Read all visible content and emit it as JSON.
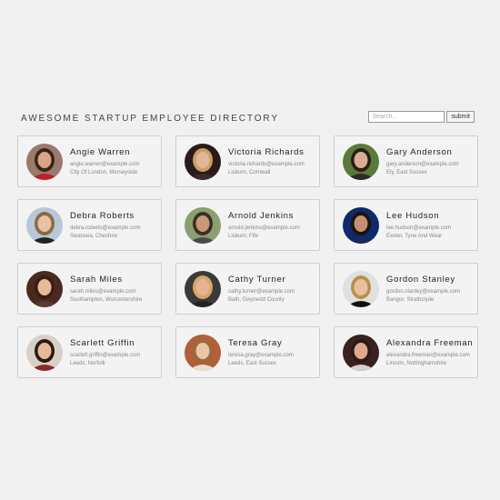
{
  "header": {
    "title": "AWESOME STARTUP EMPLOYEE DIRECTORY"
  },
  "search": {
    "placeholder": "Search...",
    "button_label": "submit"
  },
  "employees": [
    {
      "name": "Angie Warren",
      "email": "angie.warren@example.com",
      "location": "City Of London, Merseyside",
      "hair": "#3a2418",
      "skin": "#d9a58a",
      "bg": "#9a7a6a",
      "shirt": "#c0202a"
    },
    {
      "name": "Victoria Richards",
      "email": "victoria.richards@example.com",
      "location": "Lisburn, Cornwall",
      "hair": "#c8a060",
      "skin": "#e2b59a",
      "bg": "#2a1a1a",
      "shirt": "#3a2a30"
    },
    {
      "name": "Gary Anderson",
      "email": "gary.anderson@example.com",
      "location": "Ely, East Sussex",
      "hair": "#2a1e18",
      "skin": "#d8ae92",
      "bg": "#5a7a3a",
      "shirt": "#2a2a2a"
    },
    {
      "name": "Debra Roberts",
      "email": "debra.roberts@example.com",
      "location": "Swansea, Cheshire",
      "hair": "#8a6a40",
      "skin": "#e8c2a8",
      "bg": "#b8c8d8",
      "shirt": "#222"
    },
    {
      "name": "Arnold Jenkins",
      "email": "arnold.jenkins@example.com",
      "location": "Lisburn, Fife",
      "hair": "#3a2e22",
      "skin": "#c89878",
      "bg": "#8aa070",
      "shirt": "#4a4a48"
    },
    {
      "name": "Lee Hudson",
      "email": "lee.hudson@example.com",
      "location": "Exeter, Tyne And Wear",
      "hair": "#1a1410",
      "skin": "#c4906e",
      "bg": "#0e2a6a",
      "shirt": "#1a2a5a"
    },
    {
      "name": "Sarah Miles",
      "email": "sarah.miles@example.com",
      "location": "Southampton, Worcestershire",
      "hair": "#3a1e14",
      "skin": "#e8b89a",
      "bg": "#4a2a20",
      "shirt": "#5a3a30"
    },
    {
      "name": "Cathy Turner",
      "email": "cathy.turner@example.com",
      "location": "Bath, Gwynedd County",
      "hair": "#d4a860",
      "skin": "#e6b494",
      "bg": "#3a3a3a",
      "shirt": "#222"
    },
    {
      "name": "Gordon Stanley",
      "email": "gordon.stanley@example.com",
      "location": "Bangor, Strathclyde",
      "hair": "#b8904a",
      "skin": "#e8c0a0",
      "bg": "#e0e0e0",
      "shirt": "#111"
    },
    {
      "name": "Scarlett Griffin",
      "email": "scarlett.griffin@example.com",
      "location": "Leeds, Norfolk",
      "hair": "#2a1a14",
      "skin": "#e8b898",
      "bg": "#d8d0c8",
      "shirt": "#8a2a2a"
    },
    {
      "name": "Teresa Gray",
      "email": "teresa.gray@example.com",
      "location": "Leeds, East Sussex",
      "hair": "#9a6a3a",
      "skin": "#ecc4a6",
      "bg": "#b0603a",
      "shirt": "#e8e0d0"
    },
    {
      "name": "Alexandra Freeman",
      "email": "alexandra.freeman@example.com",
      "location": "Lincoln, Nottinghamshire",
      "hair": "#2a1a14",
      "skin": "#e0a88a",
      "bg": "#3a2020",
      "shirt": "#d8d0c8"
    }
  ]
}
